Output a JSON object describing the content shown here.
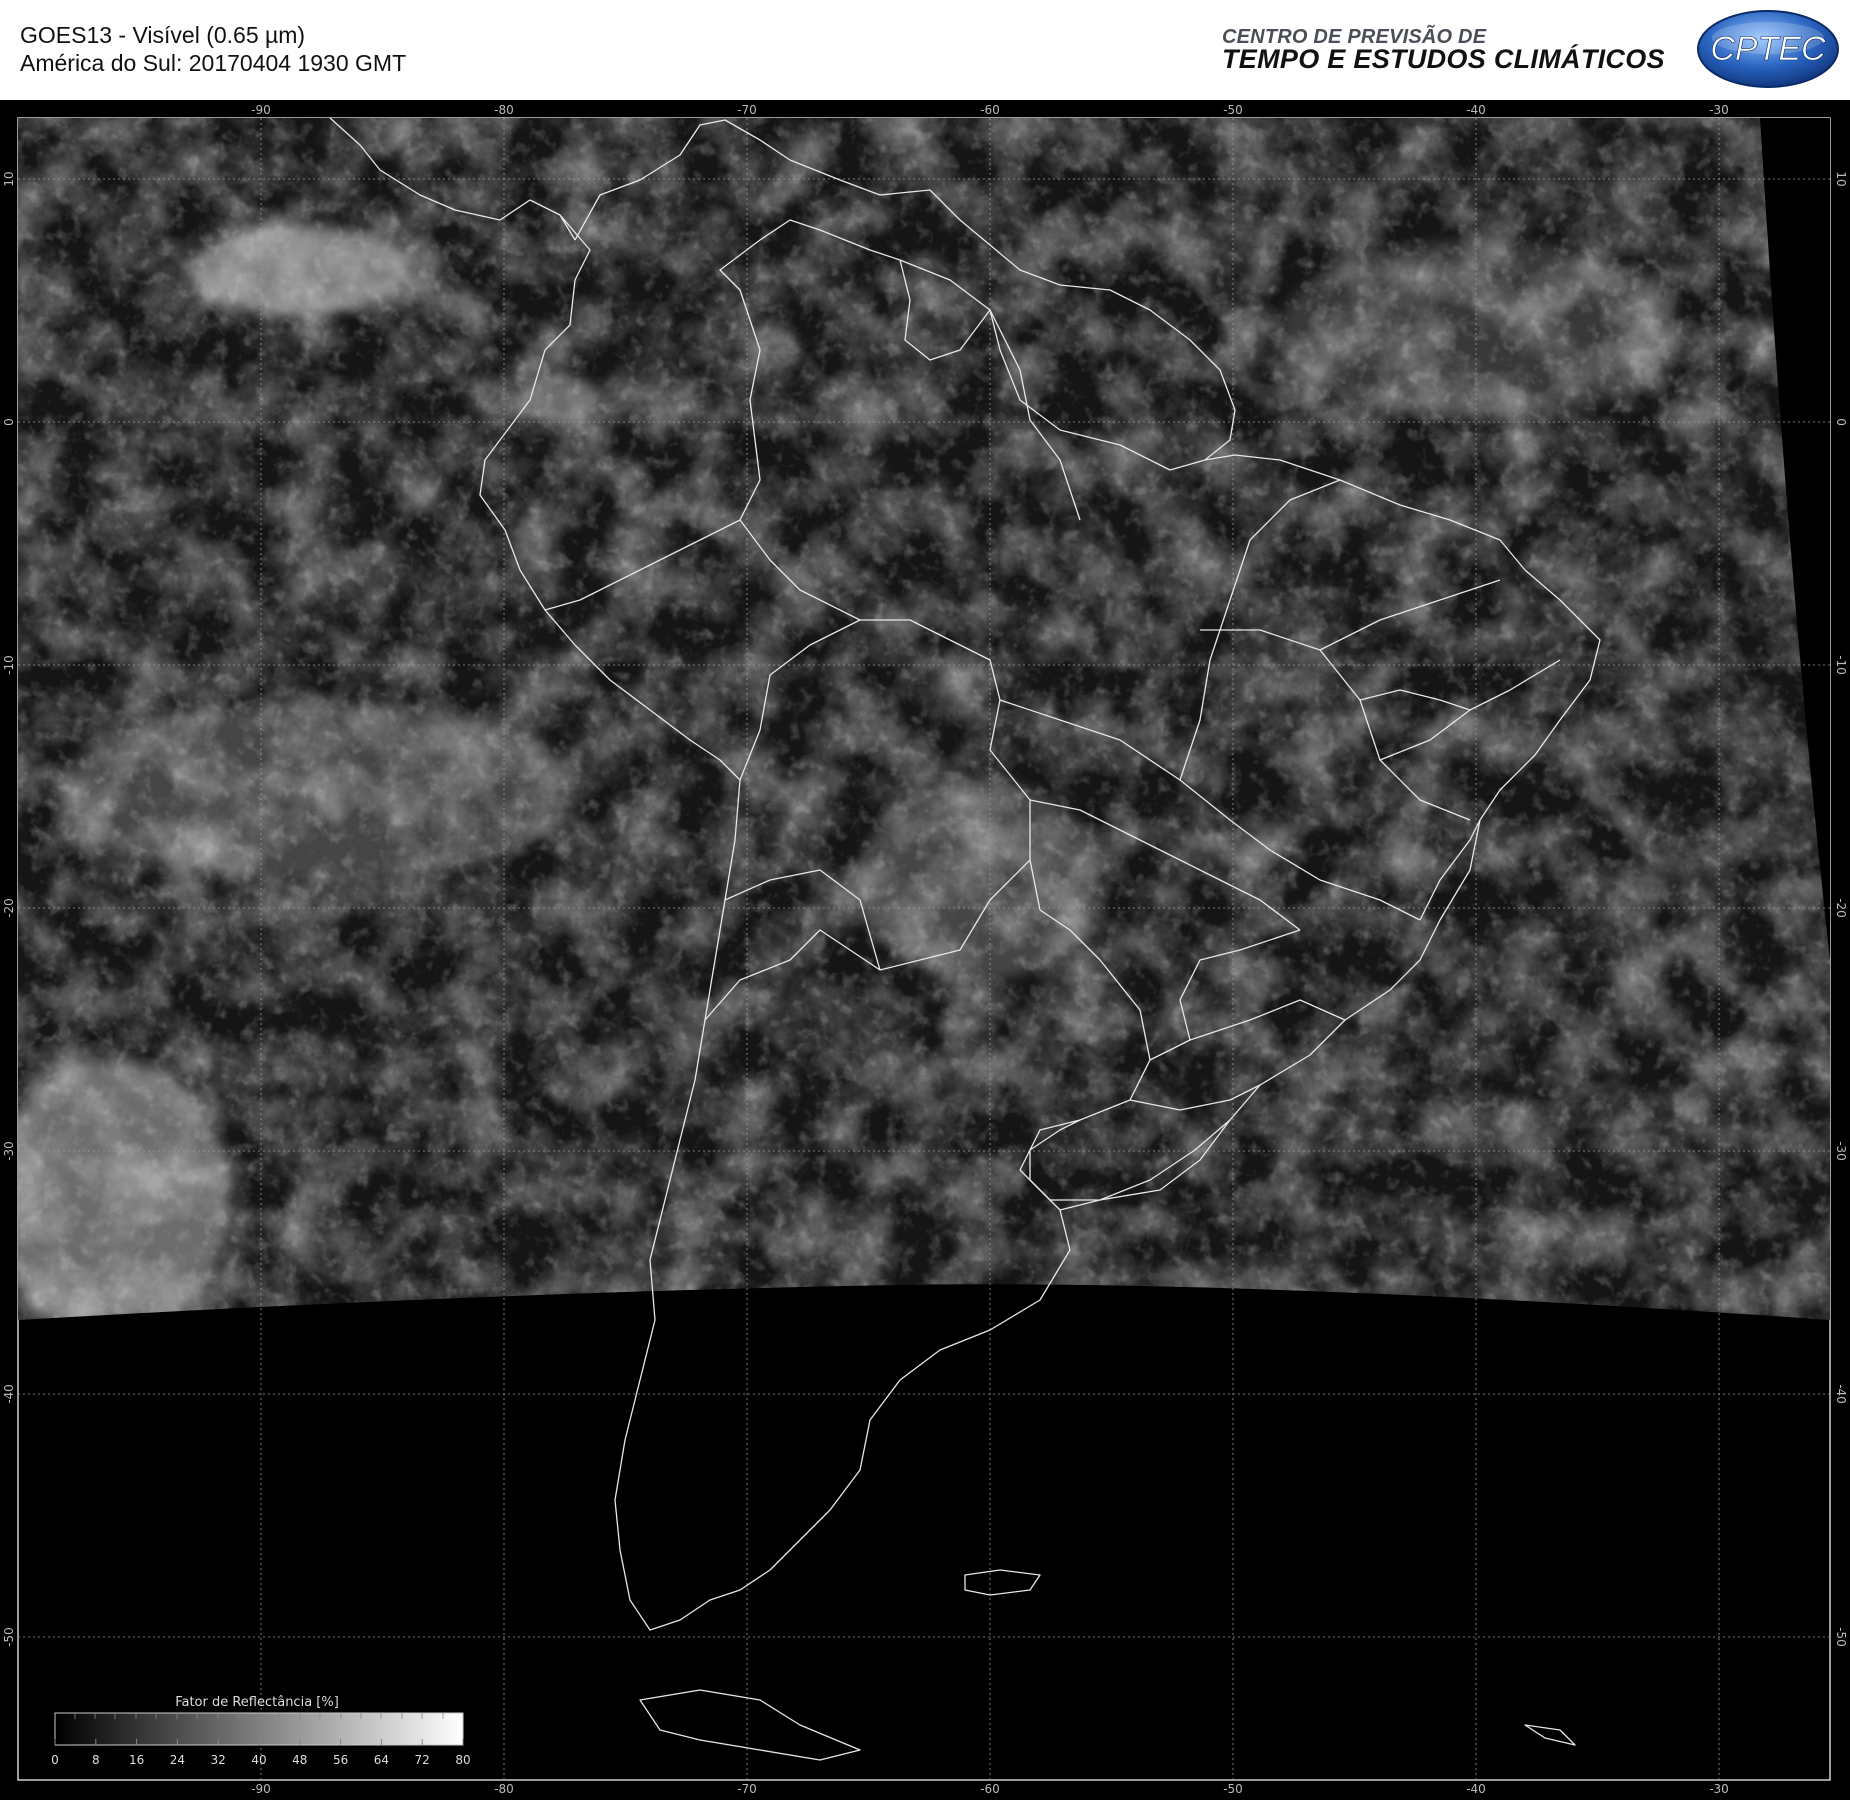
{
  "header": {
    "title_line1": "GOES13 - Visível (0.65 µm)",
    "title_line2": "América do Sul: 20170404 1930 GMT",
    "org_line1": "CENTRO DE PREVISÃO DE",
    "org_line2": "TEMPO E ESTUDOS CLIMÁTICOS",
    "logo_text": "CPTEC"
  },
  "map": {
    "longitude_labels": [
      "-90",
      "-80",
      "-70",
      "-60",
      "-50",
      "-40",
      "-30"
    ],
    "latitude_labels": [
      "10",
      "0",
      "-10",
      "-20",
      "-30",
      "-40",
      "-50"
    ],
    "lon_range": [
      -100,
      -25
    ],
    "lat_range": [
      12.5,
      -56
    ]
  },
  "colorbar": {
    "title": "Fator de Reflectância [%]",
    "ticks": [
      "0",
      "8",
      "16",
      "24",
      "32",
      "40",
      "48",
      "56",
      "64",
      "72",
      "80"
    ],
    "range": [
      0,
      80
    ]
  },
  "colors": {
    "background": "#000000",
    "grid": "#9a9a9a",
    "borders": "#e8e8e8",
    "logo_blue": "#1f56a8"
  }
}
